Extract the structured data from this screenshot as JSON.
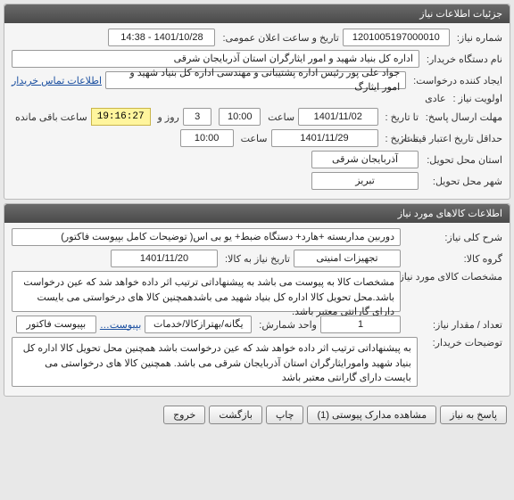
{
  "panel1": {
    "title": "جزئیات اطلاعات نیاز",
    "request_no_label": "شماره نیاز:",
    "request_no": "1201005197000010",
    "announce_label": "تاریخ و ساعت اعلان عمومی:",
    "announce_value": "1401/10/28 - 14:38",
    "buyer_label": "نام دستگاه خریدار:",
    "buyer_value": "اداره کل بنیاد شهید و امور ایثارگران استان آذربایجان شرقی",
    "creator_label": "ایجاد کننده درخواست:",
    "creator_value": "جواد علی پور رئیس اداره پشتیبانی و مهندسی اداره کل بنیاد شهید و امور ایثارگ",
    "contact_link": "اطلاعات تماس خریدار",
    "priority_label": "اولویت نیاز :",
    "priority_value": "عادی",
    "deadline_label": "مهلت ارسال پاسخ:",
    "to_date_label": "تا تاریخ :",
    "deadline_date": "1401/11/02",
    "time_label": "ساعت",
    "deadline_time": "10:00",
    "days_value": "3",
    "days_label": "روز و",
    "countdown": "19:16:27",
    "remaining_label": "ساعت باقی مانده",
    "validity_label": "حداقل تاریخ اعتبار قیمت:",
    "validity_date": "1401/11/29",
    "validity_time": "10:00",
    "province_label": "استان محل تحویل:",
    "province_value": "آذربایجان شرقی",
    "city_label": "شهر محل تحویل:",
    "city_value": "تبریز"
  },
  "panel2": {
    "title": "اطلاعات کالاهای مورد نیاز",
    "need_title_label": "شرح کلی نیاز:",
    "need_title": "دوربین مداربسته +هارد+ دستگاه ضبط+ یو بی اس( توضیحات کامل بپیوست فاکتور)",
    "group_label": "گروه کالا:",
    "group_value": "تجهیزات امنیتی",
    "need_date_label": "تاریخ نیاز به کالا:",
    "need_date": "1401/11/20",
    "spec_label": "مشخصات کالای مورد نیاز:",
    "spec_text": "مشخصات کالا به پیوست می باشد به پیشنهاداتی ترتیب اثر داده خواهد شد که عین درخواست باشد.محل تحویل کالا اداره کل بنیاد شهید می باشدهمچنین کالا های درخواستی می بایست دارای گارانتی معتبر باشد.",
    "qty_label": "تعداد / مقدار نیاز:",
    "qty_value": "1",
    "unit_label": "واحد شمارش:",
    "unit_value": "یگانه/بهترازکالا/خدمات",
    "attach_link": "بپیوست…",
    "attach_text": "بپیوست فاکتور",
    "buyer_notes_label": "توضیحات خریدار:",
    "buyer_notes": "به پیشنهاداتی ترتیب اثر داده خواهد شد که عین درخواست باشد همچنین محل تحویل کالا اداره کل بنیاد شهید وامورایثارگران استان آذربایجان شرقی می باشد. همچنین کالا های درخواستی می بایست دارای گارانتی معتبر باشد"
  },
  "buttons": {
    "reply": "پاسخ به نیاز",
    "view_docs": "مشاهده مدارک پیوستی (1)",
    "print": "چاپ",
    "back": "بازگشت",
    "exit": "خروج"
  }
}
